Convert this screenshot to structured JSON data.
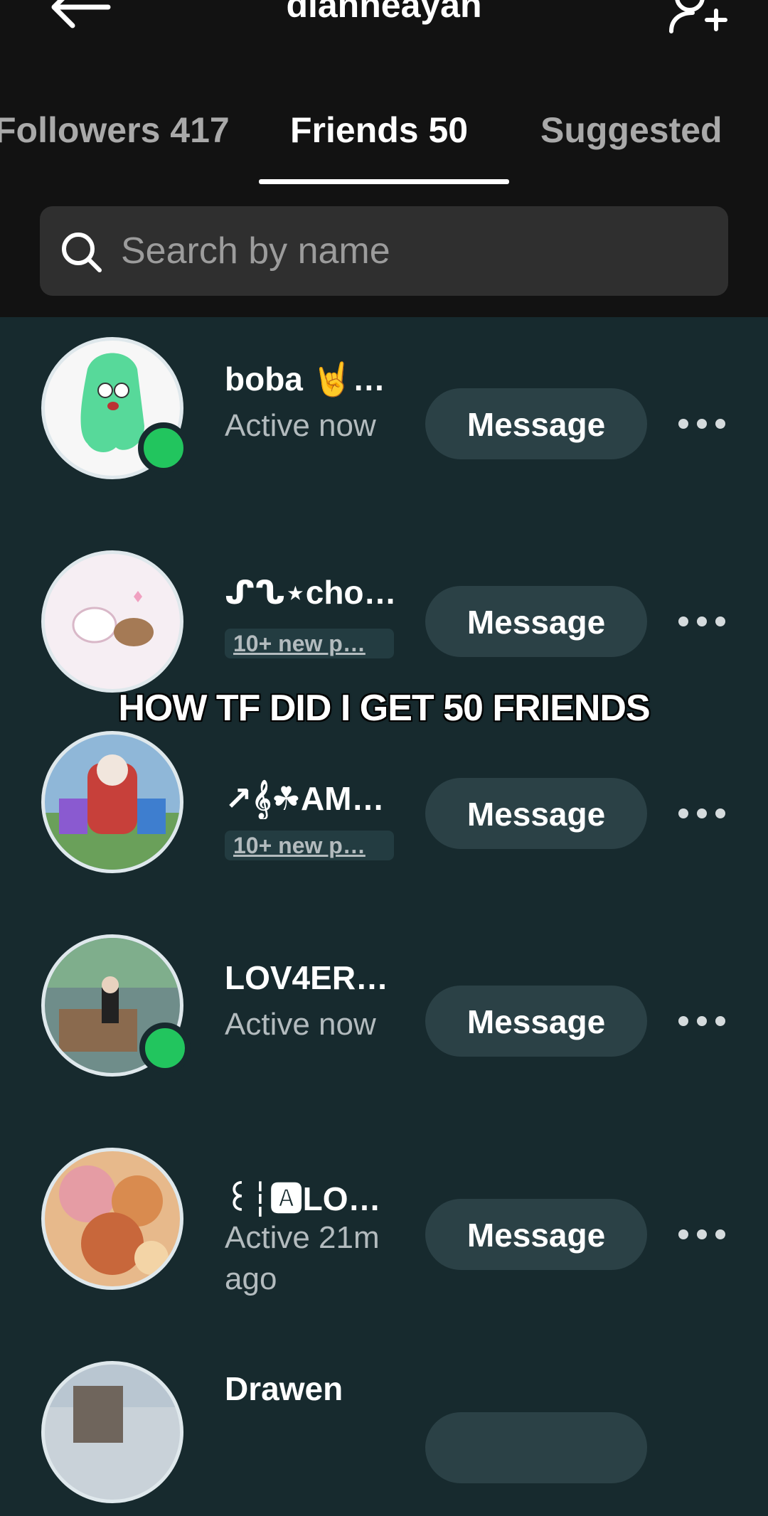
{
  "header": {
    "title": "dianneayah",
    "back_icon": "arrow-left-icon",
    "add_icon": "add-user-icon"
  },
  "tabs": [
    {
      "label": "Followers 417",
      "active": false
    },
    {
      "label": "Friends 50",
      "active": true
    },
    {
      "label": "Suggested",
      "active": false
    }
  ],
  "search": {
    "placeholder": "Search by name",
    "icon": "search-icon"
  },
  "overlay_caption": "HOW TF DID I GET 50 FRIENDS",
  "friends": [
    {
      "name": "boba 🤘…",
      "status": "Active now",
      "online": true,
      "button": "Message"
    },
    {
      "name": "ᔑᔐ⋆choc…",
      "status": "10+ new p…",
      "online": false,
      "button": "Message"
    },
    {
      "name": "↗𝄞☘AM…",
      "status": "10+ new p…",
      "online": false,
      "button": "Message"
    },
    {
      "name": "LOV4ER…",
      "status": "Active now",
      "online": true,
      "button": "Message"
    },
    {
      "name": "꒰┆🅰LO…",
      "status": "Active 21m ago",
      "online": false,
      "button": "Message"
    },
    {
      "name": "Drawen",
      "status": "",
      "online": false,
      "button": ""
    }
  ],
  "colors": {
    "header_bg": "#121212",
    "list_bg": "#172a2e",
    "button_bg": "#2b4146",
    "online": "#22c55e"
  }
}
